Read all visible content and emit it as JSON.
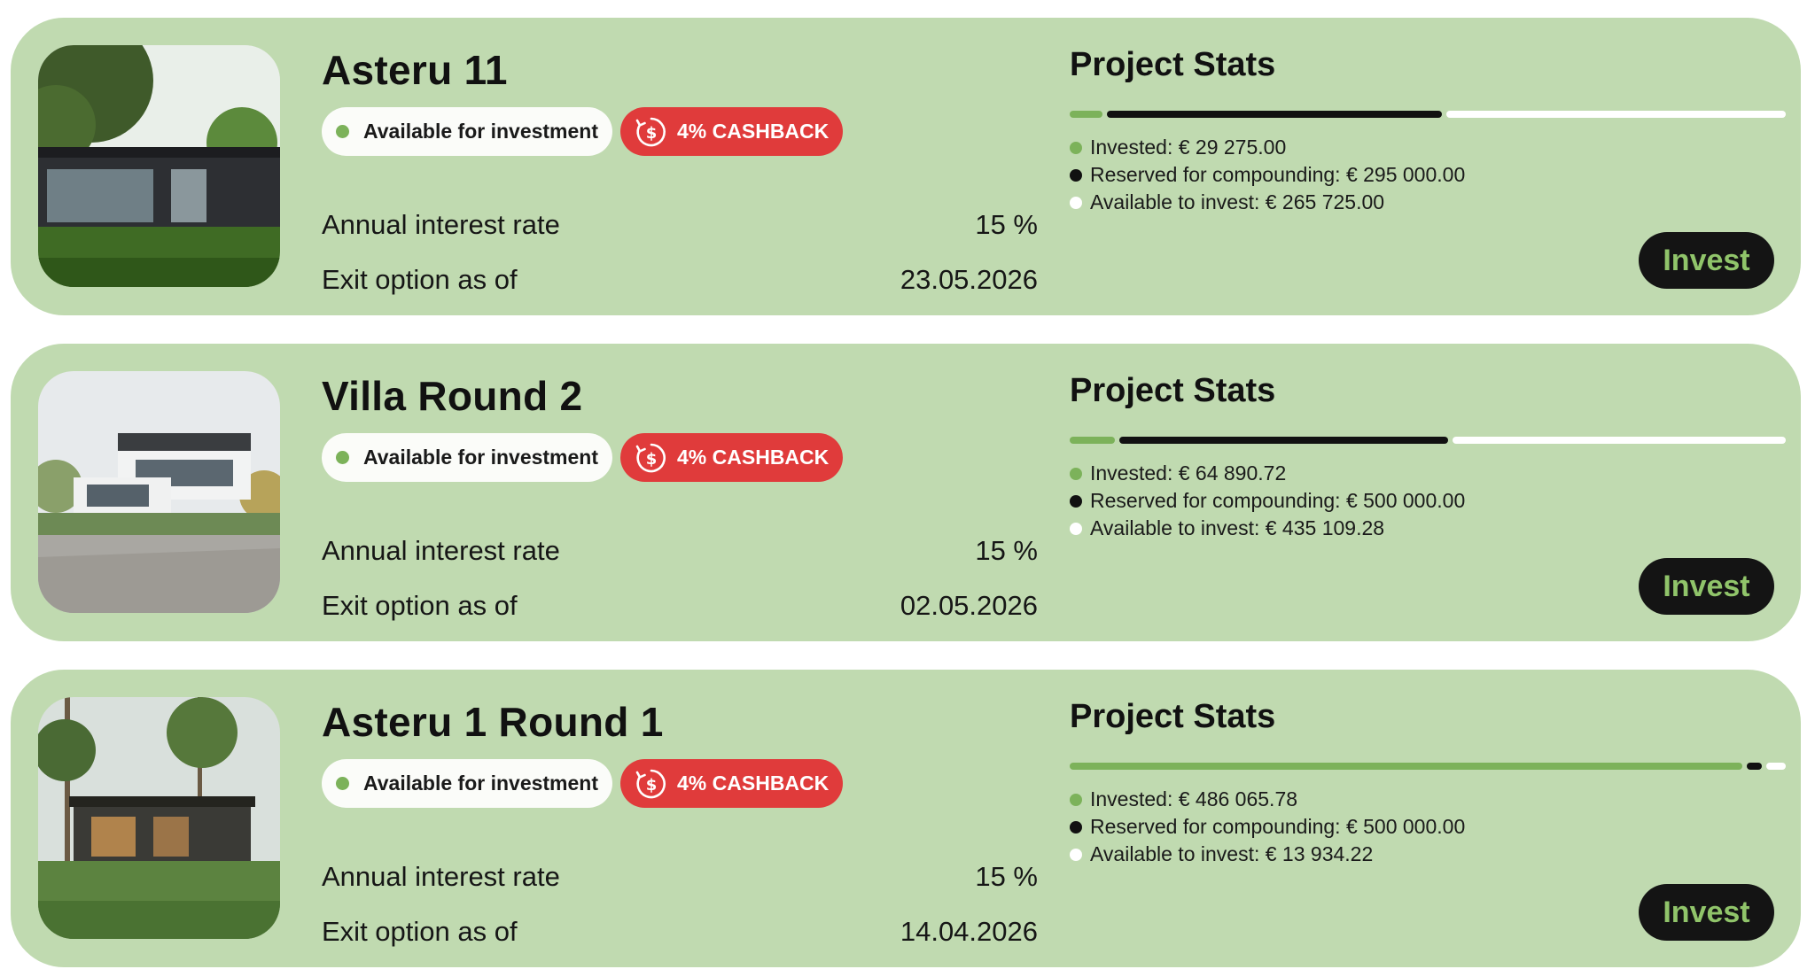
{
  "projects": [
    {
      "name": "Asteru 11",
      "status": "Available for investment",
      "cashback": "4% CASHBACK",
      "rate_label": "Annual interest rate",
      "rate_value": "15 %",
      "exit_label": "Exit option as of",
      "exit_value": "23.05.2026",
      "stats_title": "Project Stats",
      "invested_text": "Invested: € 29 275.00",
      "reserved_text": "Reserved for compounding: € 295 000.00",
      "available_text": "Available to invest: € 265 725.00",
      "invested": 29275.0,
      "reserved": 295000.0,
      "available": 265725.0,
      "button": "Invest",
      "image": "modern-house-photo"
    },
    {
      "name": "Villa Round 2",
      "status": "Available for investment",
      "cashback": "4% CASHBACK",
      "rate_label": "Annual interest rate",
      "rate_value": "15 %",
      "exit_label": "Exit option as of",
      "exit_value": "02.05.2026",
      "stats_title": "Project Stats",
      "invested_text": "Invested: € 64 890.72",
      "reserved_text": "Reserved for compounding: € 500 000.00",
      "available_text": "Available to invest: € 435 109.28",
      "invested": 64890.72,
      "reserved": 500000.0,
      "available": 435109.28,
      "button": "Invest",
      "image": "villa-photo"
    },
    {
      "name": "Asteru 1 Round 1",
      "status": "Available for investment",
      "cashback": "4% CASHBACK",
      "rate_label": "Annual interest rate",
      "rate_value": "15 %",
      "exit_label": "Exit option as of",
      "exit_value": "14.04.2026",
      "stats_title": "Project Stats",
      "invested_text": "Invested: € 486 065.78",
      "reserved_text": "Reserved for compounding: € 500 000.00",
      "available_text": "Available to invest: € 13 934.22",
      "invested": 486065.78,
      "reserved": 500000.0,
      "available": 13934.22,
      "button": "Invest",
      "image": "forest-house-photo"
    }
  ],
  "colors": {
    "card_bg": "#c0dab0",
    "invested": "#7cb25a",
    "reserved": "#111111",
    "available": "#ffffff",
    "cashback_bg": "#e03b3b",
    "button_bg": "#141414",
    "button_text": "#90c46a"
  }
}
